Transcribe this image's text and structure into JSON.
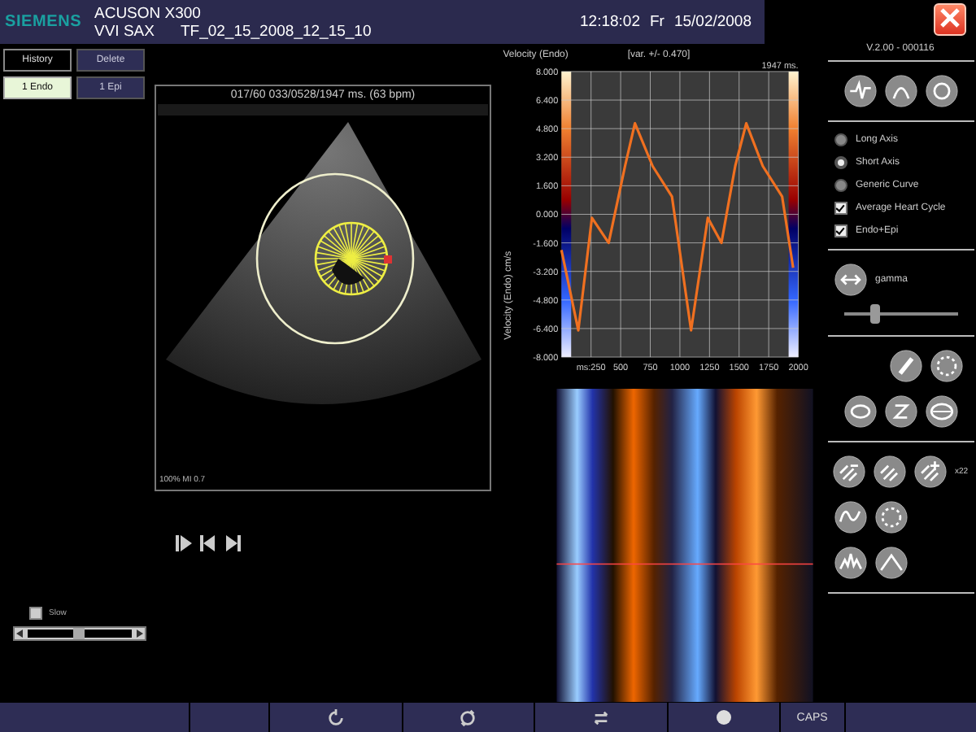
{
  "header": {
    "logo": "SIEMENS",
    "system": "ACUSON X300",
    "study": "VVI SAX",
    "file": "TF_02_15_2008_12_15_10",
    "time": "12:18:02",
    "day": "Fr",
    "date": "15/02/2008"
  },
  "left_panel": {
    "buttons": [
      {
        "label": "History",
        "kind": "outline",
        "selected": false
      },
      {
        "label": "Delete",
        "kind": "filled",
        "selected": false
      },
      {
        "label": "1 Endo",
        "kind": "filled",
        "selected": true
      },
      {
        "label": "1 Epi",
        "kind": "filled",
        "selected": false
      }
    ],
    "slow": {
      "label": "Slow",
      "checked": false
    },
    "frame_slider": {
      "level": 0.5
    }
  },
  "image_view": {
    "info": "017/60  033/0528/1947 ms.  (63 bpm)",
    "footer": "100%  MI 0.7"
  },
  "chart": {
    "variance": "[var. +/- 0.470]",
    "duration": "1947 ms.",
    "chart_data": {
      "type": "line",
      "title": "Velocity (Endo)",
      "grid": true,
      "ylabel": "Velocity (Endo) cm/s",
      "xlim": [
        0,
        2000
      ],
      "ylim": [
        -8,
        8
      ],
      "xticks": [
        {
          "value": 250,
          "label": "ms:250"
        },
        500,
        750,
        1000,
        1250,
        1500,
        1750,
        2000
      ],
      "yticks": [
        {
          "value": 8,
          "label": "8.000"
        },
        {
          "value": 6.4,
          "label": "6.400"
        },
        {
          "value": 4.8,
          "label": "4.800"
        },
        {
          "value": 3.2,
          "label": "3.200"
        },
        {
          "value": 1.6,
          "label": "1.600"
        },
        {
          "value": 0,
          "label": "0.000"
        },
        {
          "value": -1.6,
          "label": "-1.600"
        },
        {
          "value": -3.2,
          "label": "-3.200"
        },
        {
          "value": -4.8,
          "label": "-4.800"
        },
        {
          "value": -6.4,
          "label": "-6.400"
        },
        {
          "value": -8,
          "label": "-8.000"
        }
      ],
      "x": [
        0,
        142,
        258,
        398,
        537,
        621,
        770,
        933,
        1095,
        1235,
        1351,
        1467,
        1560,
        1700,
        1863,
        1956
      ],
      "series": [
        {
          "color": "#f07020",
          "values": [
            -2.0,
            -6.5,
            -0.2,
            -1.6,
            2.7,
            5.1,
            2.7,
            1.0,
            -6.5,
            -0.2,
            -1.6,
            2.7,
            5.1,
            2.7,
            1.0,
            -3.0
          ]
        }
      ]
    }
  },
  "right_panel": {
    "version": "V.2.00 - 000116",
    "views": [
      {
        "label": "Long Axis",
        "selected": false
      },
      {
        "label": "Short Axis",
        "selected": true
      },
      {
        "label": "Generic Curve",
        "selected": false
      }
    ],
    "options": [
      {
        "label": "Average Heart Cycle",
        "checked": true
      },
      {
        "label": "Endo+Epi",
        "checked": true
      }
    ],
    "gamma": {
      "label": "gamma",
      "level": 0.28
    },
    "zoom_label": "x22"
  },
  "bottom_bar": {
    "caps": "CAPS"
  }
}
